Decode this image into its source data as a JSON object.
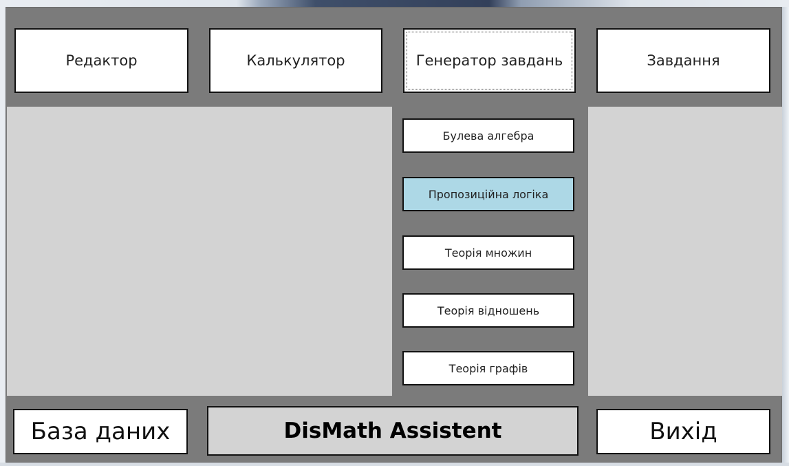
{
  "top_menu": {
    "editor": "Редактор",
    "calculator": "Калькулятор",
    "task_generator": "Генератор завдань",
    "tasks": "Завдання"
  },
  "generator_menu": {
    "items": [
      "Булева алгебра",
      "Пропозиційна логіка",
      "Теорія множин",
      "Теорія відношень",
      "Теорія графів"
    ],
    "highlighted": "Пропозиційна логіка"
  },
  "bottom_bar": {
    "database": "База даних",
    "app_title": "DisMath Assistent",
    "exit": "Вихід"
  },
  "colors": {
    "background": "#7b7b7b",
    "panel": "#d3d3d3",
    "button": "#ffffff",
    "highlight": "#add8e6"
  }
}
